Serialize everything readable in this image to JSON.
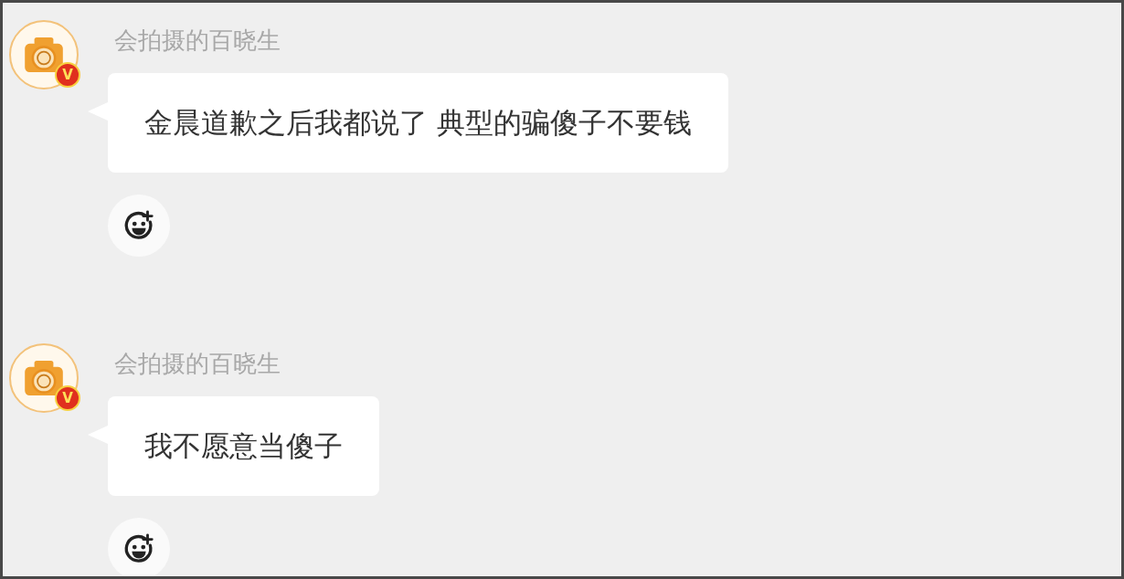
{
  "messages": [
    {
      "sender": "会拍摄的百晓生",
      "verified_badge": "V",
      "text": "金晨道歉之后我都说了 典型的骗傻子不要钱"
    },
    {
      "sender": "会拍摄的百晓生",
      "verified_badge": "V",
      "text": "我不愿意当傻子"
    }
  ]
}
